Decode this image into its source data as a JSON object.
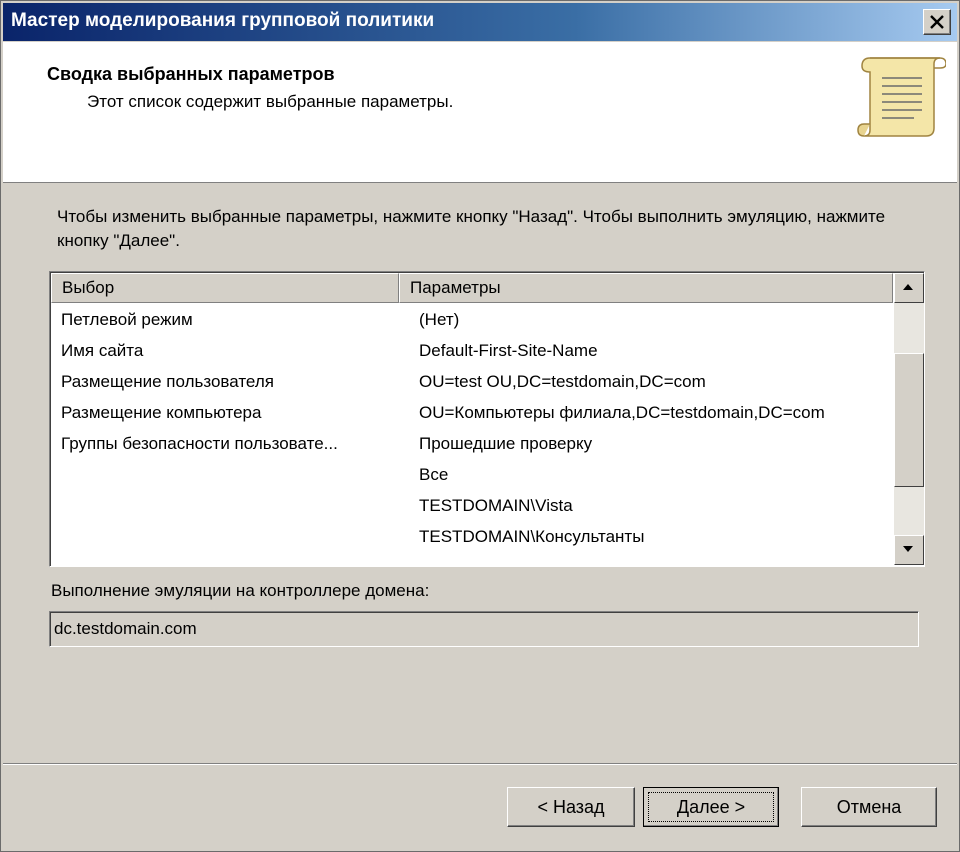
{
  "window": {
    "title": "Мастер моделирования групповой политики"
  },
  "header": {
    "title": "Сводка выбранных параметров",
    "subtitle": "Этот список содержит выбранные параметры."
  },
  "instruction": "Чтобы изменить выбранные параметры, нажмите кнопку \"Назад\". Чтобы выполнить эмуляцию, нажмите кнопку \"Далее\".",
  "list": {
    "columns": [
      "Выбор",
      "Параметры"
    ],
    "rows": [
      {
        "choice": "Петлевой режим",
        "value": "(Нет)"
      },
      {
        "choice": "Имя сайта",
        "value": "Default-First-Site-Name"
      },
      {
        "choice": "Размещение пользователя",
        "value": "OU=test OU,DC=testdomain,DC=com"
      },
      {
        "choice": "Размещение компьютера",
        "value": "OU=Компьютеры филиала,DC=testdomain,DC=com"
      },
      {
        "choice": "Группы безопасности пользовате...",
        "value": "Прошедшие проверку"
      },
      {
        "choice": "",
        "value": "Все"
      },
      {
        "choice": "",
        "value": "TESTDOMAIN\\Vista"
      },
      {
        "choice": "",
        "value": "TESTDOMAIN\\Консультанты"
      }
    ]
  },
  "dc": {
    "label": "Выполнение эмуляции на контроллере домена:",
    "value": "dc.testdomain.com"
  },
  "buttons": {
    "back": "< Назад",
    "next": "Далее >",
    "cancel": "Отмена"
  }
}
